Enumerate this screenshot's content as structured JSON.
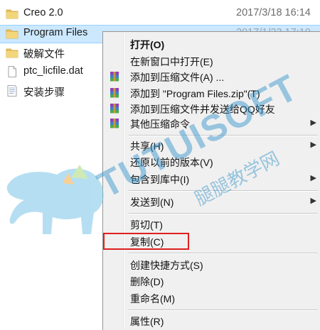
{
  "files": [
    {
      "name": "Creo 2.0",
      "date": "2017/3/18 16:14",
      "icon": "folder-icon"
    },
    {
      "name": "Program Files",
      "date": "2017/1/23 17:10",
      "icon": "folder-icon",
      "selected": true
    },
    {
      "name": "破解文件",
      "date": "",
      "icon": "folder-icon"
    },
    {
      "name": "ptc_licfile.dat",
      "date": "",
      "icon": "file-icon"
    },
    {
      "name": "安装步骤",
      "date": "",
      "icon": "text-file-icon"
    }
  ],
  "menu": {
    "open": "打开(O)",
    "open_new_window": "在新窗口中打开(E)",
    "add_to_archive": "添加到压缩文件(A) ...",
    "add_to_zip": "添加到 \"Program Files.zip\"(T)",
    "add_and_send_qq": "添加到压缩文件并发送给QQ好友",
    "other_compress": "其他压缩命令",
    "share": "共享(H)",
    "restore_previous": "还原以前的版本(V)",
    "include_in_library": "包含到库中(I)",
    "send_to": "发送到(N)",
    "cut": "剪切(T)",
    "copy": "复制(C)",
    "create_shortcut": "创建快捷方式(S)",
    "delete": "删除(D)",
    "rename": "重命名(M)",
    "properties": "属性(R)"
  },
  "watermark": {
    "brand": "TUTUISOFT",
    "subtitle": "腿腿教学网"
  },
  "colors": {
    "selection": "#cce8ff",
    "highlight_border": "#e01f1f",
    "folder": "#e8c25a",
    "watermark": "#2a8fc8"
  }
}
